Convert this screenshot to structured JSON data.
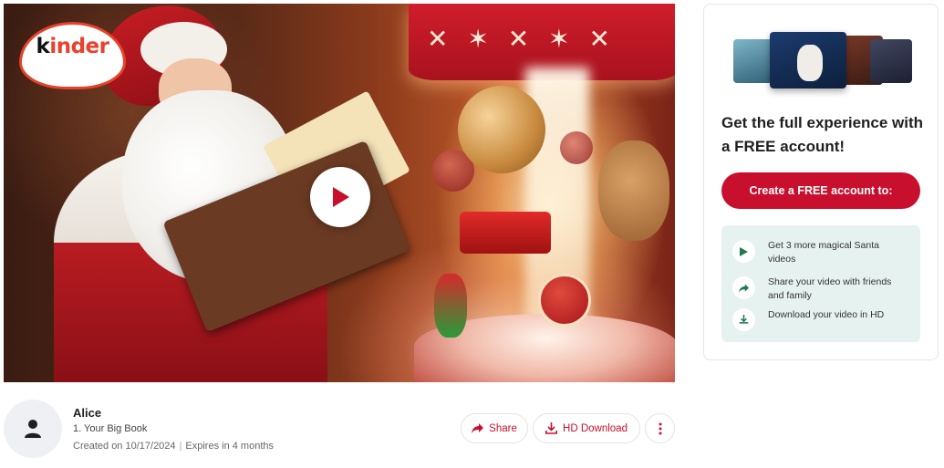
{
  "video": {
    "logo_text_k": "k",
    "logo_text_rest": "inder"
  },
  "info": {
    "name": "Alice",
    "title": "1. Your Big Book",
    "created": "Created on 10/17/2024",
    "separator": "|",
    "expires": "Expires in 4 months"
  },
  "actions": {
    "share_label": "Share",
    "hd_download_label": "HD Download"
  },
  "card": {
    "heading": "Get the full experience with a FREE account!",
    "cta_label": "Create a FREE account to:",
    "benefits": [
      {
        "icon": "play-icon",
        "text": "Get 3 more magical Santa videos"
      },
      {
        "icon": "share-arrow-icon",
        "text": "Share your video with friends and family"
      },
      {
        "icon": "download-icon",
        "text": "Download your video in HD"
      }
    ]
  },
  "colors": {
    "brand_red": "#c8102e",
    "benefit_bg": "#e6f2ef",
    "benefit_icon": "#1f7a4d",
    "kinder_orange": "#e8412c"
  }
}
